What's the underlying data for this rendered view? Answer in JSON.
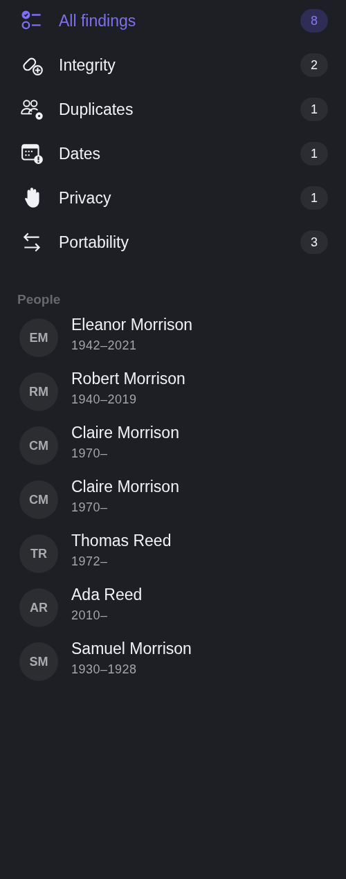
{
  "categories": [
    {
      "label": "All findings",
      "count": "8",
      "selected": true
    },
    {
      "label": "Integrity",
      "count": "2",
      "selected": false
    },
    {
      "label": "Duplicates",
      "count": "1",
      "selected": false
    },
    {
      "label": "Dates",
      "count": "1",
      "selected": false
    },
    {
      "label": "Privacy",
      "count": "1",
      "selected": false
    },
    {
      "label": "Portability",
      "count": "3",
      "selected": false
    }
  ],
  "people_heading": "People",
  "people": [
    {
      "initials": "EM",
      "name": "Eleanor Morrison",
      "dates": "1942–2021"
    },
    {
      "initials": "RM",
      "name": "Robert Morrison",
      "dates": "1940–2019"
    },
    {
      "initials": "CM",
      "name": "Claire Morrison",
      "dates": "1970–"
    },
    {
      "initials": "CM",
      "name": "Claire Morrison",
      "dates": "1970–"
    },
    {
      "initials": "TR",
      "name": "Thomas Reed",
      "dates": "1972–"
    },
    {
      "initials": "AR",
      "name": "Ada Reed",
      "dates": "2010–"
    },
    {
      "initials": "SM",
      "name": "Samuel Morrison",
      "dates": "1930–1928"
    }
  ]
}
